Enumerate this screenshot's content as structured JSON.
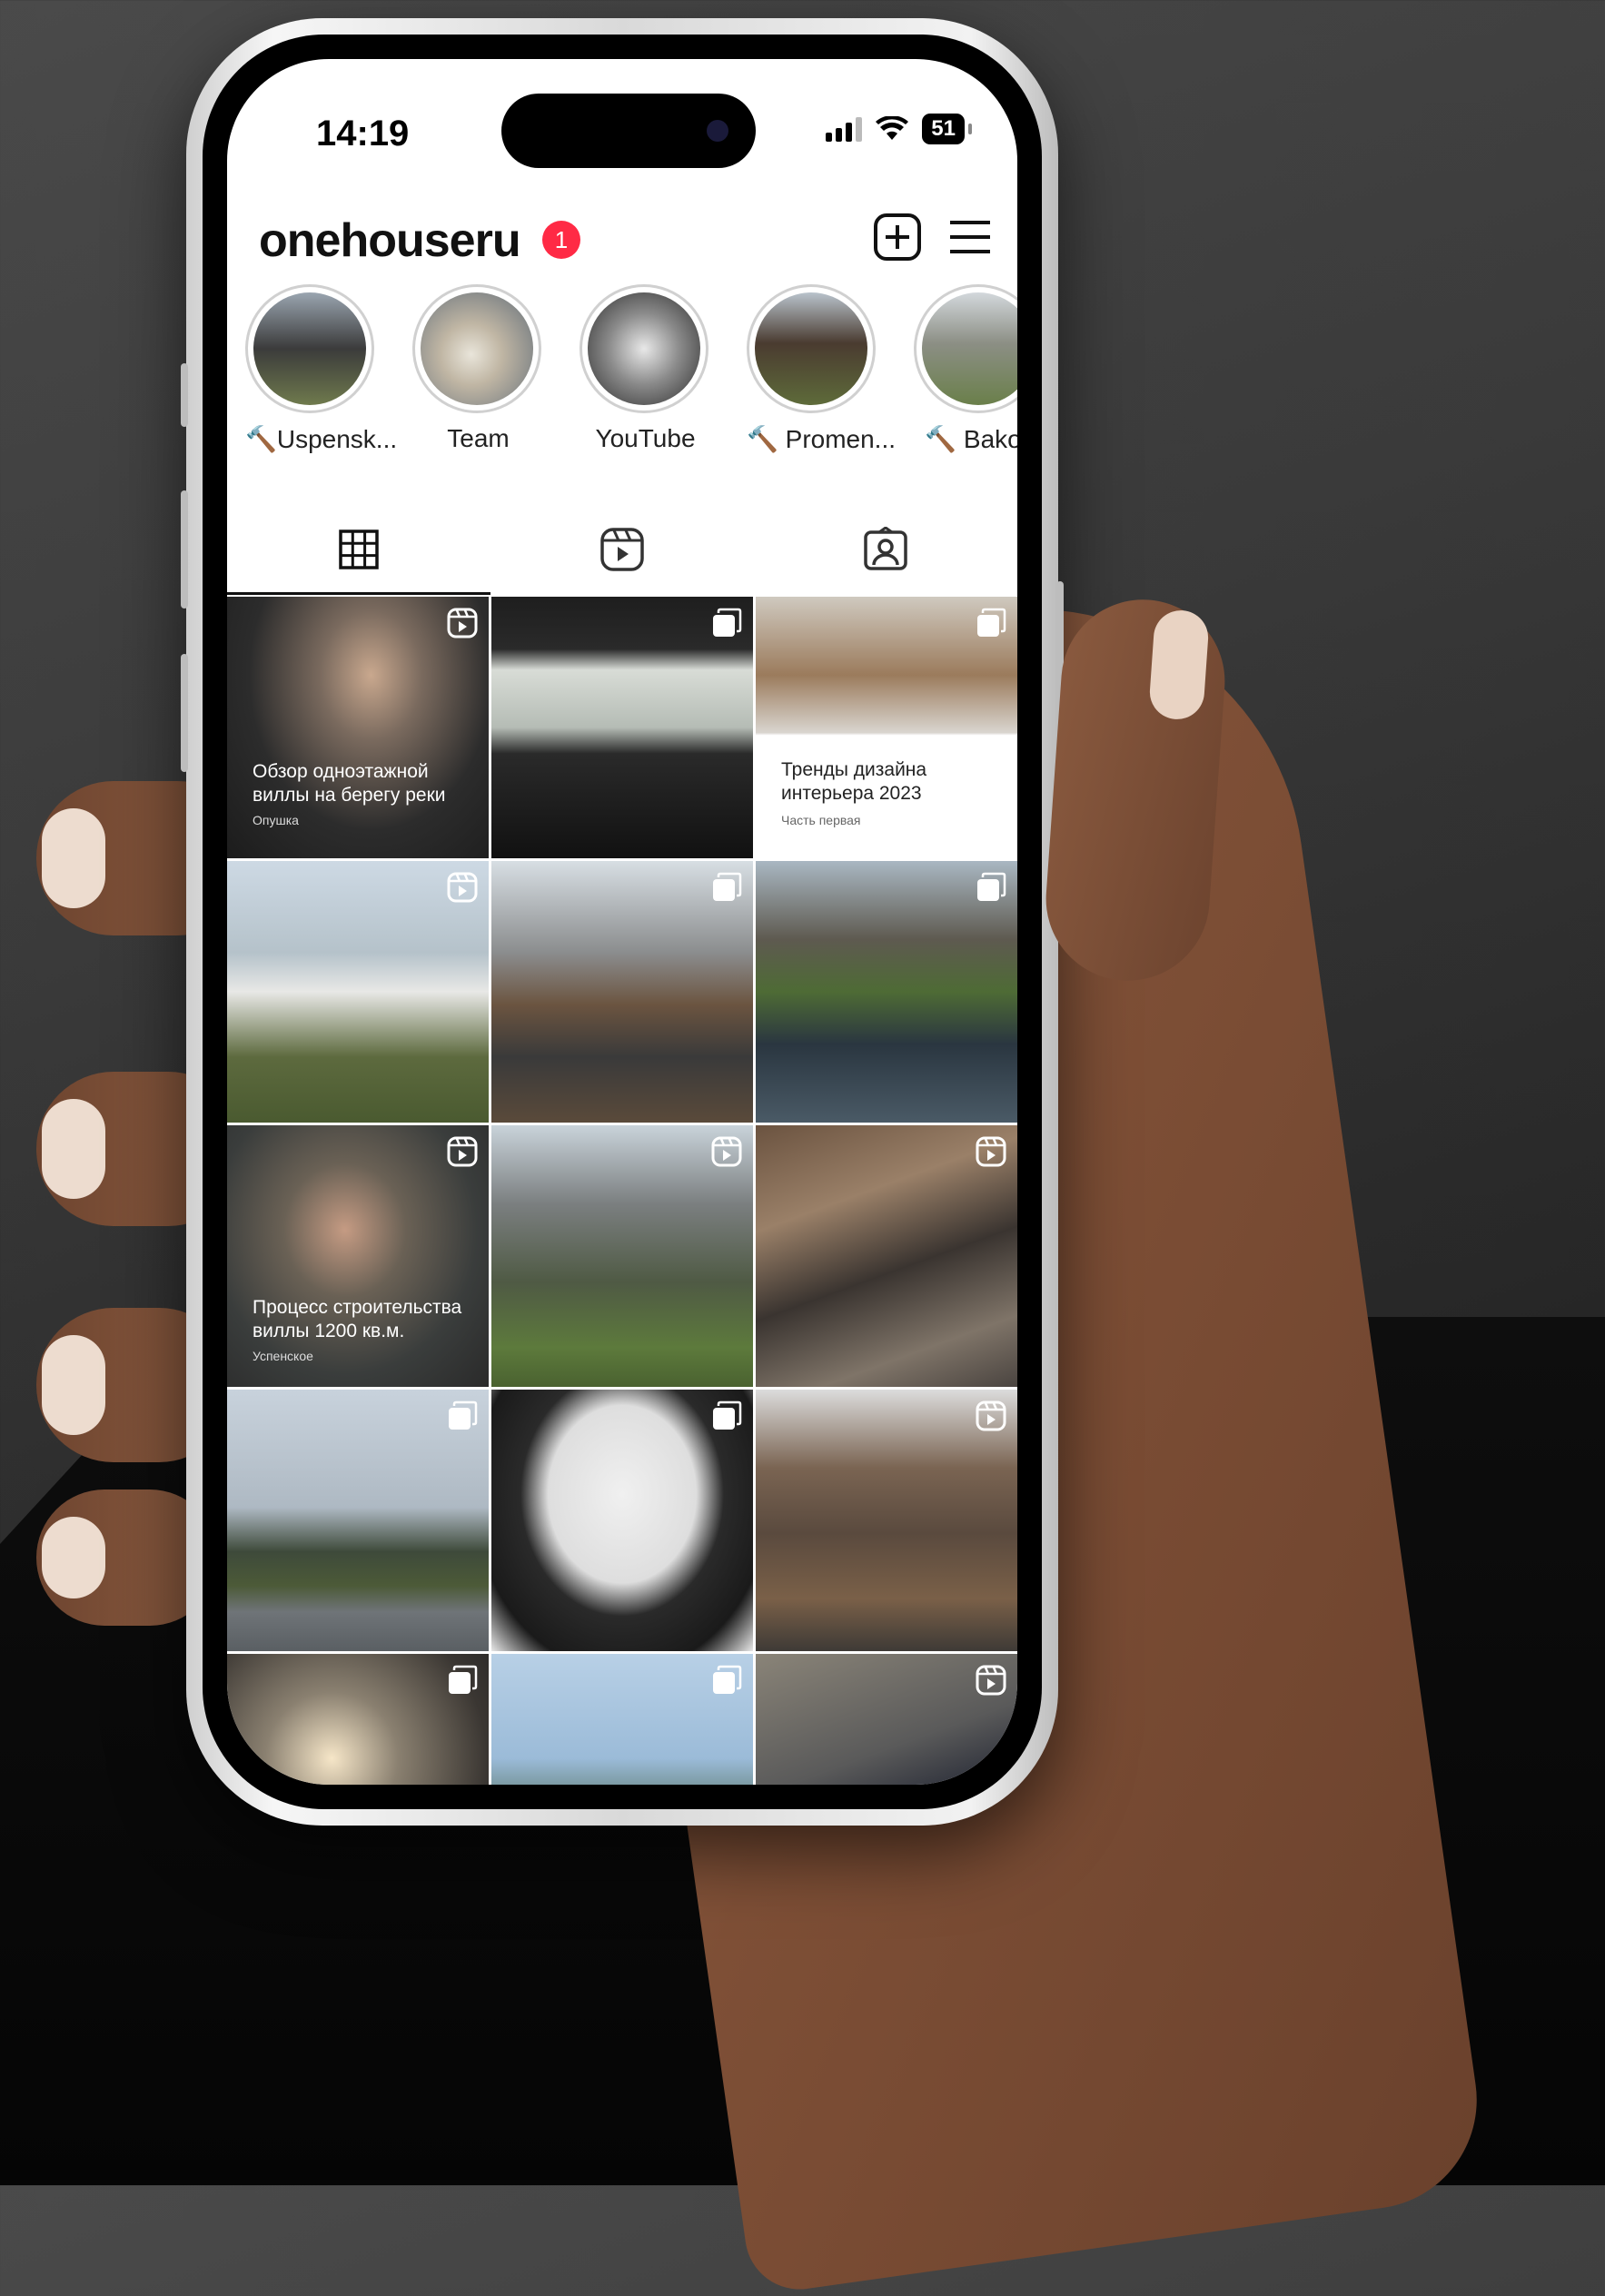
{
  "status_bar": {
    "time": "14:19",
    "battery": "51"
  },
  "profile": {
    "username": "onehouseru",
    "notification_count": "1"
  },
  "highlights": [
    {
      "label": "🔨Uspensk..."
    },
    {
      "label": "Team"
    },
    {
      "label": "YouTube"
    },
    {
      "label": "🔨 Promen..."
    },
    {
      "label": "🔨 Bakov"
    }
  ],
  "tabs": [
    {
      "label": "posts",
      "icon": "grid-icon",
      "active": true
    },
    {
      "label": "reels",
      "icon": "reels-icon",
      "active": false
    },
    {
      "label": "tagged",
      "icon": "tagged-icon",
      "active": false
    }
  ],
  "posts": [
    {
      "type": "reel",
      "caption": "Обзор одноэтажной виллы на берегу реки",
      "subcaption": "Опушка"
    },
    {
      "type": "carousel",
      "caption": "",
      "subcaption": ""
    },
    {
      "type": "carousel",
      "caption": "Тренды дизайна интерьера 2023",
      "subcaption": "Часть первая"
    },
    {
      "type": "reel",
      "caption": "",
      "subcaption": ""
    },
    {
      "type": "carousel",
      "caption": "",
      "subcaption": ""
    },
    {
      "type": "carousel",
      "caption": "",
      "subcaption": ""
    },
    {
      "type": "reel",
      "caption": "Процесс строительства виллы 1200 кв.м.",
      "subcaption": "Успенское"
    },
    {
      "type": "reel",
      "caption": "",
      "subcaption": ""
    },
    {
      "type": "reel",
      "caption": "",
      "subcaption": ""
    },
    {
      "type": "carousel",
      "caption": "",
      "subcaption": ""
    },
    {
      "type": "carousel",
      "caption": "",
      "subcaption": ""
    },
    {
      "type": "reel",
      "caption": "",
      "subcaption": ""
    },
    {
      "type": "carousel",
      "caption": "",
      "subcaption": ""
    },
    {
      "type": "carousel",
      "caption": "",
      "subcaption": ""
    },
    {
      "type": "reel",
      "caption": "",
      "subcaption": ""
    }
  ],
  "colors": {
    "badge": "#ff2a45",
    "text": "#111111"
  }
}
